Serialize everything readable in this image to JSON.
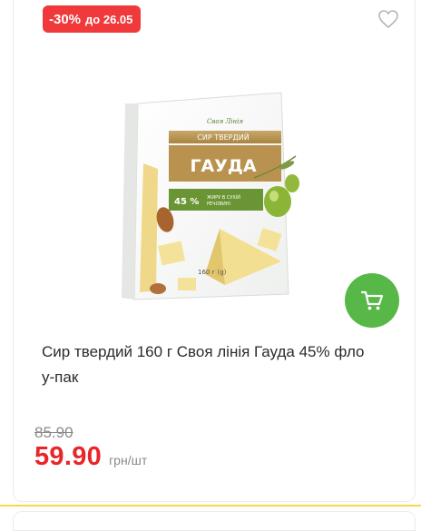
{
  "badge": {
    "discount": "-30%",
    "valid_until": "до 26.05",
    "color": "#f0393b"
  },
  "favorite": {
    "icon": "heart-outline-icon"
  },
  "image": {
    "package_brand": "Своя Лінія",
    "package_category": "СИР ТВЕРДИЙ",
    "package_name": "ГАУДА",
    "package_fat": "45 %",
    "package_fat_note_1": "ЖИРУ В СУХІЙ",
    "package_fat_note_2": "РЕЧОВИНІ",
    "package_weight": "160 г (g)"
  },
  "cart": {
    "icon": "cart-icon",
    "color": "#57b847"
  },
  "product": {
    "title_line1": "Сир твердий 160 г Своя лінія Гауда 45% фло",
    "title_line2": "у-пак"
  },
  "price": {
    "old": "85.90",
    "current": "59.90",
    "unit": "грн/шт",
    "accent": "#e8262a"
  }
}
